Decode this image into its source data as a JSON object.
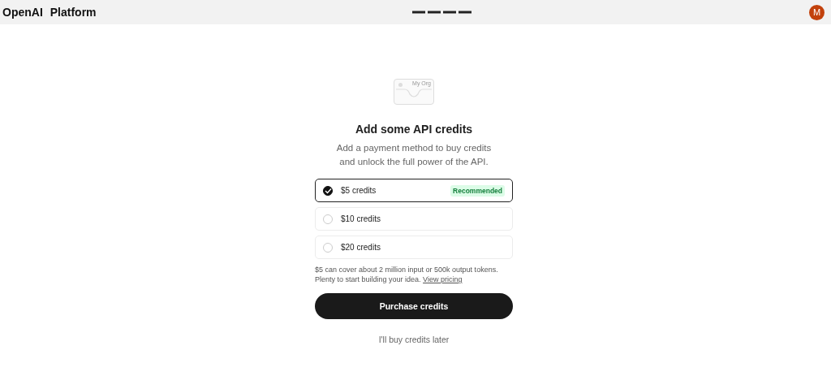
{
  "header": {
    "logo": "OpenAI",
    "product": "Platform",
    "avatar": "M"
  },
  "illustration": {
    "card_label": "My Org"
  },
  "title": "Add some API credits",
  "subtitle": "Add a payment method to buy credits and unlock the full power of the API.",
  "options": [
    {
      "label": "$5 credits",
      "selected": true,
      "badge": "Recommended"
    },
    {
      "label": "$10 credits",
      "selected": false
    },
    {
      "label": "$20 credits",
      "selected": false
    }
  ],
  "note": {
    "text": "$5 can cover about 2 million input or 500k output tokens. Plenty to start building your idea.",
    "link": "View pricing"
  },
  "primary_button": "Purchase credits",
  "secondary_link": "I'll buy credits later"
}
